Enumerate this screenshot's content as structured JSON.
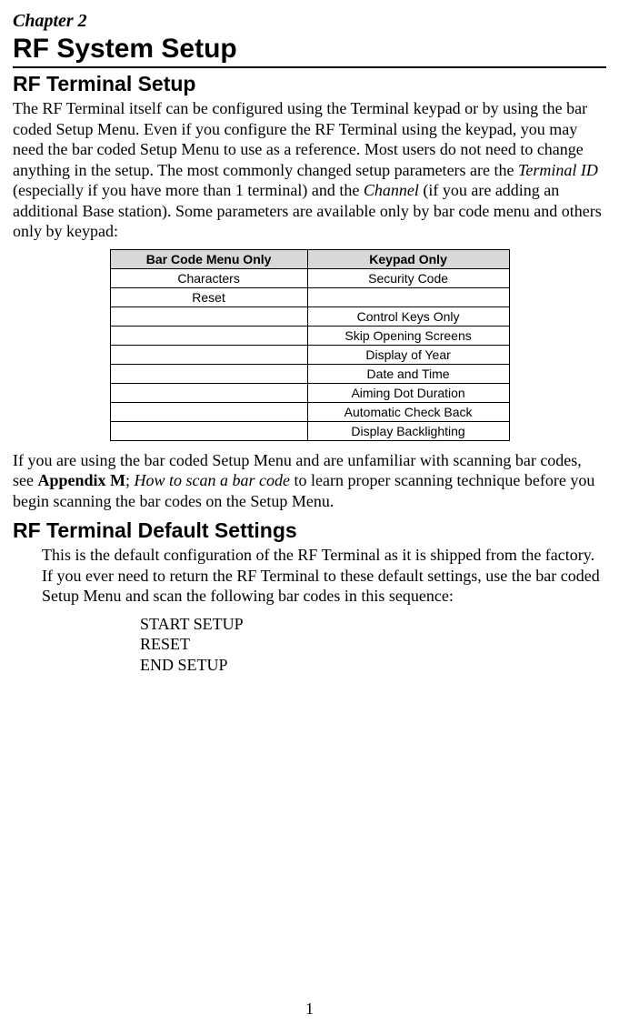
{
  "chapter": "Chapter 2",
  "title": "RF System Setup",
  "section1": "RF Terminal Setup",
  "intro": {
    "p1a": "The RF Terminal itself can be configured using the Terminal keypad or by using the bar coded Setup Menu. Even if you configure the RF Terminal using the keypad, you may need the bar coded Setup Menu to use as a reference.  Most users do not need to change anything in the setup. The most commonly changed setup parameters are the ",
    "p1_em1": "Terminal ID",
    "p1b": " (especially if you have more than 1 terminal) and the ",
    "p1_em2": "Channel",
    "p1c": " (if you are adding an additional Base station).  Some parameters are available only by bar code menu and others only by keypad:"
  },
  "table": {
    "h1": "Bar Code Menu Only",
    "h2": "Keypad Only",
    "rows": [
      {
        "c1": "Characters",
        "c2": "Security Code"
      },
      {
        "c1": "Reset",
        "c2": ""
      },
      {
        "c1": "",
        "c2": "Control Keys Only"
      },
      {
        "c1": "",
        "c2": "Skip Opening Screens"
      },
      {
        "c1": "",
        "c2": "Display of Year"
      },
      {
        "c1": "",
        "c2": "Date and Time"
      },
      {
        "c1": "",
        "c2": "Aiming Dot Duration"
      },
      {
        "c1": "",
        "c2": "Automatic Check Back"
      },
      {
        "c1": "",
        "c2": "Display Backlighting"
      }
    ]
  },
  "after_table": {
    "a": "If you are using the bar coded Setup Menu and are unfamiliar with scanning bar codes, see ",
    "bold": "Appendix M",
    "b": "; ",
    "em": "How to scan a bar code",
    "c": " to learn proper scanning technique before you begin scanning the bar codes on the Setup Menu."
  },
  "section2": "RF Terminal Default Settings",
  "defaults_para": "This is the default configuration of the RF Terminal as it is shipped from the factory.  If you ever need to return the RF Terminal to these default settings, use the bar coded Setup Menu and scan the following bar codes in this sequence:",
  "sequence": {
    "l1": "START SETUP",
    "l2": "RESET",
    "l3": "END SETUP"
  },
  "page_number": "1"
}
